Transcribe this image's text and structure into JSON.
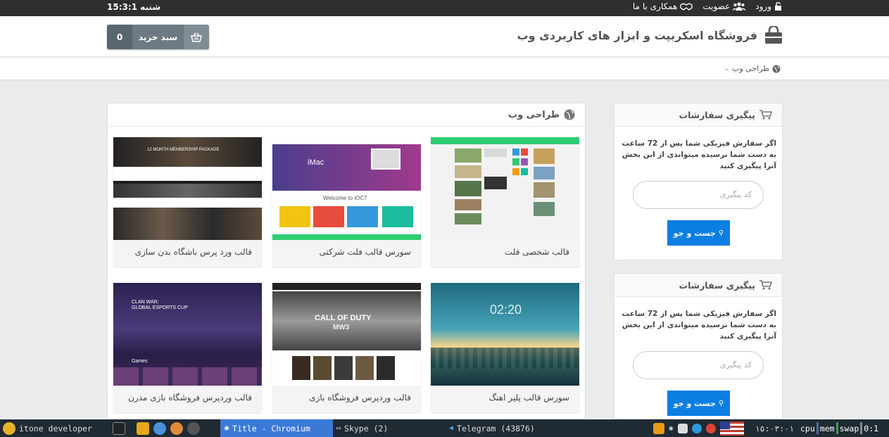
{
  "topbar": {
    "clock": "شنبه 15:3:1",
    "links": {
      "login": "ورود",
      "register": "عضویت",
      "cooperate": "همکاری با ما"
    }
  },
  "header": {
    "brand": "فروشگاه اسکریپت و ابزار های کاربردی وب",
    "cart_label": "سبد خرید",
    "cart_count": "0"
  },
  "breadcrumb": {
    "item": "طراحی وب"
  },
  "main": {
    "title": "طراحی وب",
    "products": [
      {
        "title": "قالب شخصی فلت"
      },
      {
        "title": "سورس قالب فلت شرکتی"
      },
      {
        "title": "قالب ورد پرس باشگاه بدن سازی"
      },
      {
        "title": "سورس قالب پلیر اهنگ"
      },
      {
        "title": "قالب وردپرس فروشگاه بازی"
      },
      {
        "title": "قالب وردپرس فروشگاه بازی مدرن"
      }
    ],
    "thumb_text": {
      "ioc_welcome": "Welcome to iOC7",
      "imac": "iMac",
      "gym_package": "12 MONTH MEMBERSHIP PACKAGE",
      "player_time": "02:20",
      "cod_title": "CALL OF DUTY",
      "cod_sub": "MW3",
      "esports": "CLAN WAR:",
      "esports2": "GLOBAL ESPORTS CUP",
      "games": "Games"
    }
  },
  "sidebar": [
    {
      "title": "پیگیری سفارشات",
      "desc": "اگر سفارش فیزیکی شما پس از 72 ساعت به دست شما نرسیده میتواندی از این بخش آنرا پیگیری کنید",
      "placeholder": "کد پیگیری",
      "button": "جست و جو"
    },
    {
      "title": "پیگیری سفارشات",
      "desc": "اگر سفارش فیزیکی شما پس از 72 ساعت به دست شما نرسیده میتواندی از این بخش آنرا پیگیری کنید",
      "placeholder": "کد پیگیری",
      "button": "جست و جو"
    }
  ],
  "taskbar": {
    "start": "itone developer",
    "window_active": "Title - Chromium",
    "window_skype": "Skype (2)",
    "window_telegram": "Telegram (43876)",
    "tray_time": "۱۵:۰۳:۰۱",
    "cpu": "cpu",
    "mem": "mem",
    "swap": "swap",
    "clock": "0:1"
  },
  "colors": {
    "accent": "#0b7ee2",
    "topbar": "#2f2f2f",
    "cart": "#6d7a83",
    "taskbar": "#1f2a33",
    "taskbar_active": "#3a7ad6"
  }
}
